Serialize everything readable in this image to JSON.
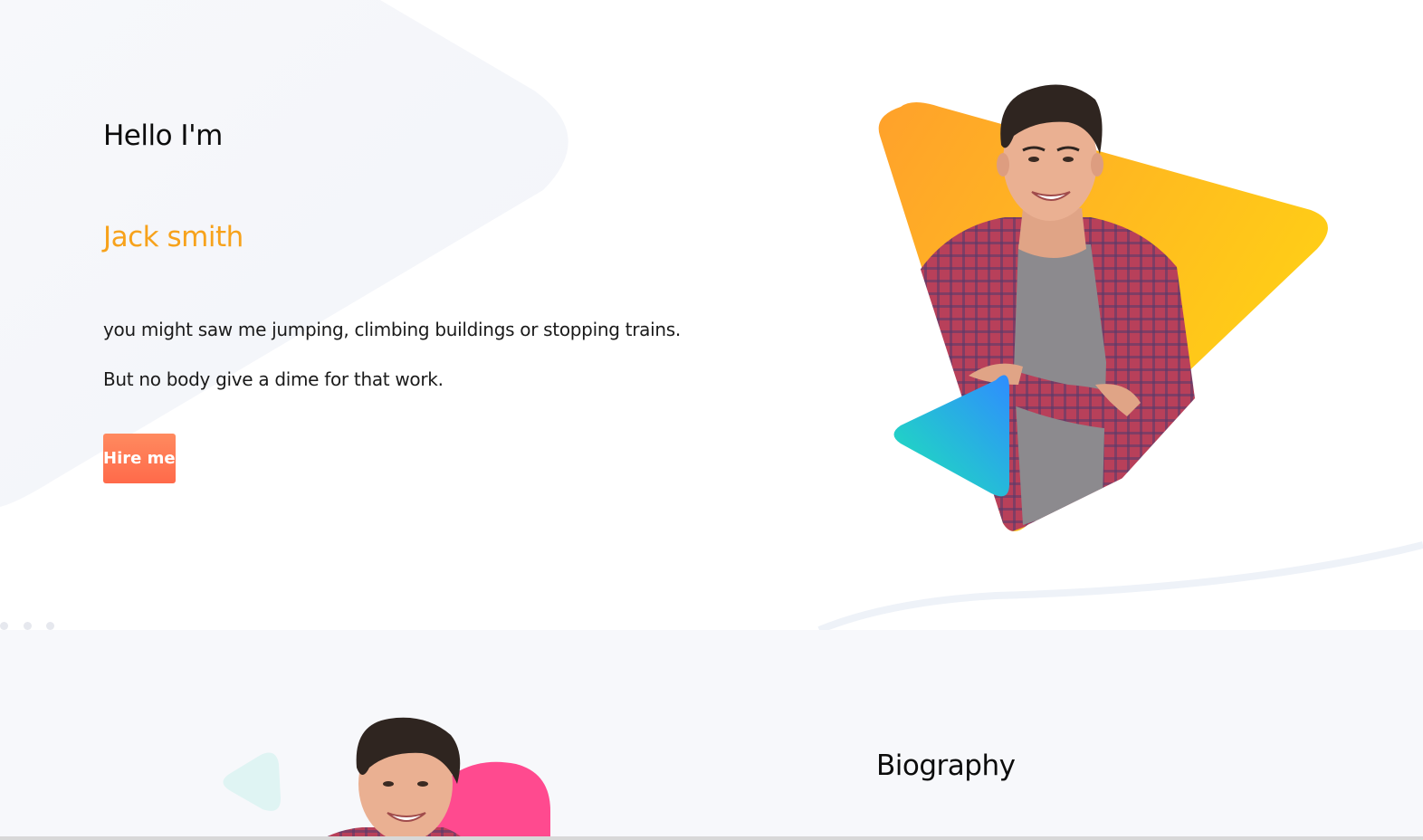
{
  "hero": {
    "greeting": "Hello I'm",
    "name": "Jack smith",
    "description_line_1": "you might saw me jumping, climbing buildings or stopping trains.",
    "description_line_2": "But no body give a dime for that work.",
    "hire_button_label": "Hire me"
  },
  "biography": {
    "title": "Biography"
  },
  "colors": {
    "accent_orange": "#f7a21b",
    "button_gradient_top": "#ff8a5f",
    "button_gradient_bottom": "#ff6a4a",
    "triangle_orange": "#ffa12b",
    "triangle_yellow": "#ffd314",
    "triangle_teal": "#1de6b6",
    "triangle_blue": "#2f8cff",
    "blob_pink": "#ff4a8f",
    "section_bg": "#f7f8fb"
  },
  "icons": {
    "play_triangle_large": "play-triangle-icon",
    "play_triangle_small": "play-triangle-icon"
  }
}
